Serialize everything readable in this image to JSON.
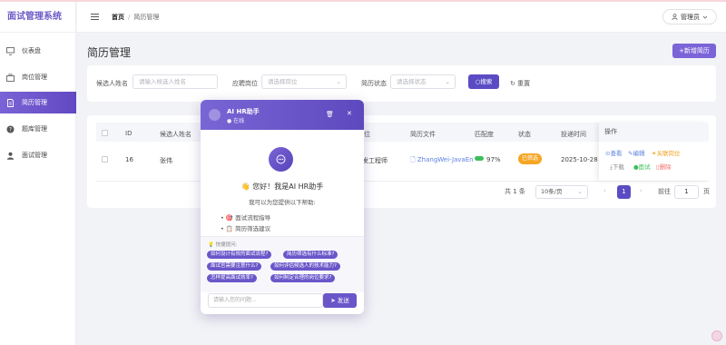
{
  "app": {
    "title": "面试管理系统"
  },
  "sidebar": {
    "items": [
      {
        "label": "仪表盘",
        "icon": "monitor-icon"
      },
      {
        "label": "岗位管理",
        "icon": "briefcase-icon"
      },
      {
        "label": "简历管理",
        "icon": "document-icon",
        "active": true
      },
      {
        "label": "题库管理",
        "icon": "question-icon"
      },
      {
        "label": "面试管理",
        "icon": "user-icon"
      }
    ]
  },
  "header": {
    "breadcrumb": [
      "首页",
      "简历管理"
    ],
    "user": "管理员"
  },
  "page": {
    "title": "简历管理",
    "add_button": "+新增简历"
  },
  "filters": {
    "name_label": "候选人姓名",
    "name_placeholder": "请输入候选人姓名",
    "position_label": "应聘岗位",
    "position_placeholder": "请选择岗位",
    "status_label": "简历状态",
    "status_placeholder": "请选择状态",
    "search": "搜索",
    "reset": "重置"
  },
  "table": {
    "headers": {
      "id": "ID",
      "name": "候选人姓名",
      "position": "位",
      "file": "简历文件",
      "match": "匹配度",
      "status": "状态",
      "time": "投递时间",
      "ops": "操作"
    },
    "rows": [
      {
        "id": "16",
        "name": "张伟",
        "position": "发工程师",
        "file": "ZhangWei-JavaEn",
        "match": "97%",
        "status": "已筛选",
        "time": "2025-10-28 14"
      }
    ],
    "ops": {
      "view": "查看",
      "edit": "编辑",
      "link": "关联岗位",
      "download": "下载",
      "interview": "面试",
      "delete": "删除"
    }
  },
  "pagination": {
    "total": "共 1 条",
    "page_size": "10条/页",
    "current": "1",
    "goto_label": "前往",
    "goto_value": "1",
    "page_suffix": "页"
  },
  "ai": {
    "name": "AI HR助手",
    "status": "● 在线",
    "greeting": "👋 您好！我是AI HR助手",
    "help": "我可以为您提供以下帮助:",
    "features": [
      "🎯 面试流程指导",
      "📋 简历筛选建议"
    ],
    "quick_title": "💡 快捷提问:",
    "chips": [
      "如何设计有效的面试流程?",
      "简历筛选有什么标准?",
      "面试官需要注意什么?",
      "如何评估候选人的技术能力?",
      "怎样提高面试效率?",
      "如何制定合理的岗位要求?"
    ],
    "input_placeholder": "请输入您的问题...",
    "send": "发送"
  },
  "colors": {
    "accent": "#6b5bc6",
    "primary": "#5b4cc4",
    "success": "#3cbf5a",
    "warning": "#f5a623",
    "danger": "#f56c6c"
  }
}
